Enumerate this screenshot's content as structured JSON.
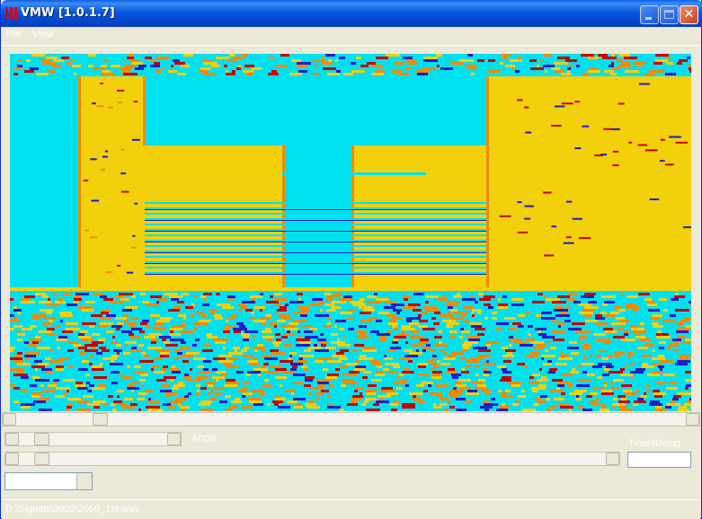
{
  "window": {
    "title": "VMW [1.0.1.7]"
  },
  "menu": {
    "items": [
      "File",
      "View"
    ]
  },
  "display": {
    "colors": {
      "cyan": "#00e1ee",
      "yellow": "#f2d00c",
      "orange": "#f08a00",
      "red": "#c80000",
      "blue": "#1e1ec8"
    }
  },
  "controls": {
    "label_angle": "Angle",
    "label_time": "Time/IDslug",
    "time_value": "",
    "combo_value": ""
  },
  "status": {
    "path": "D:\\Signals\\3003\\2050_1st.wav"
  }
}
